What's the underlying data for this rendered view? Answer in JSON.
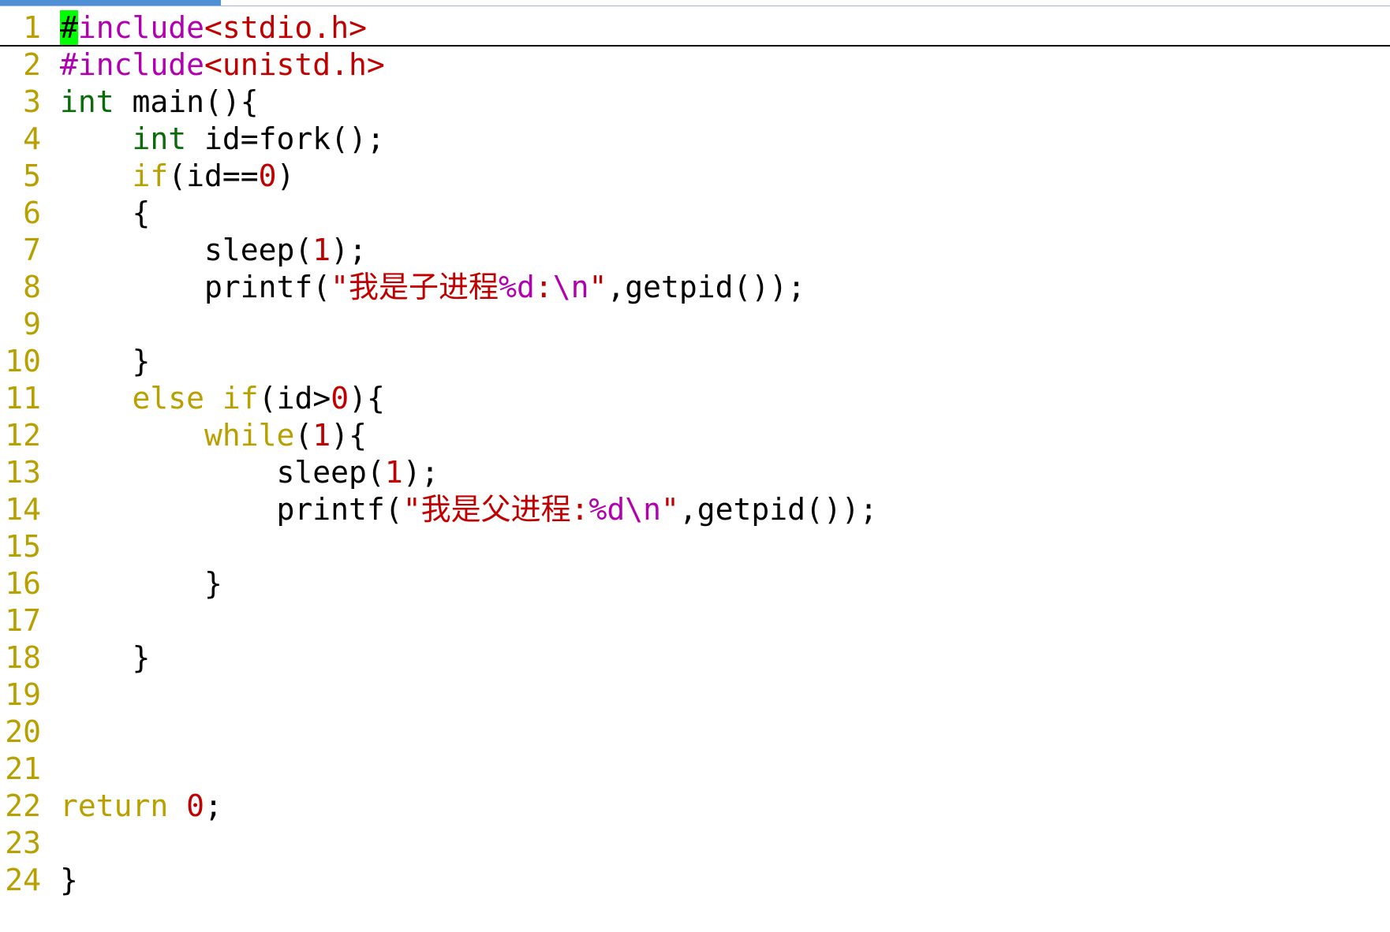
{
  "editor": {
    "lines": [
      {
        "num": "1",
        "segments": [
          {
            "text": "#",
            "cls": "cursor"
          },
          {
            "text": "include",
            "cls": "pp"
          },
          {
            "text": "<stdio.h>",
            "cls": "str"
          }
        ]
      },
      {
        "num": "2",
        "segments": [
          {
            "text": "#include",
            "cls": "pp"
          },
          {
            "text": "<unistd.h>",
            "cls": "str"
          }
        ]
      },
      {
        "num": "3",
        "segments": [
          {
            "text": "int",
            "cls": "kw-type"
          },
          {
            "text": " main(){",
            "cls": ""
          }
        ]
      },
      {
        "num": "4",
        "segments": [
          {
            "text": "    ",
            "cls": ""
          },
          {
            "text": "int",
            "cls": "kw-type"
          },
          {
            "text": " id=fork();",
            "cls": ""
          }
        ]
      },
      {
        "num": "5",
        "segments": [
          {
            "text": "    ",
            "cls": ""
          },
          {
            "text": "if",
            "cls": "kw-ctrl"
          },
          {
            "text": "(id==",
            "cls": ""
          },
          {
            "text": "0",
            "cls": "num"
          },
          {
            "text": ")",
            "cls": ""
          }
        ]
      },
      {
        "num": "6",
        "segments": [
          {
            "text": "    {",
            "cls": ""
          }
        ]
      },
      {
        "num": "7",
        "segments": [
          {
            "text": "        sleep(",
            "cls": ""
          },
          {
            "text": "1",
            "cls": "num"
          },
          {
            "text": ");",
            "cls": ""
          }
        ]
      },
      {
        "num": "8",
        "segments": [
          {
            "text": "        printf(",
            "cls": ""
          },
          {
            "text": "\"我是子进程",
            "cls": "str"
          },
          {
            "text": "%d",
            "cls": "fmt"
          },
          {
            "text": ":",
            "cls": "str"
          },
          {
            "text": "\\n",
            "cls": "fmt"
          },
          {
            "text": "\"",
            "cls": "str"
          },
          {
            "text": ",getpid());",
            "cls": ""
          }
        ]
      },
      {
        "num": "9",
        "segments": []
      },
      {
        "num": "10",
        "segments": [
          {
            "text": "    }",
            "cls": ""
          }
        ]
      },
      {
        "num": "11",
        "segments": [
          {
            "text": "    ",
            "cls": ""
          },
          {
            "text": "else",
            "cls": "kw-ctrl"
          },
          {
            "text": " ",
            "cls": ""
          },
          {
            "text": "if",
            "cls": "kw-ctrl"
          },
          {
            "text": "(id>",
            "cls": ""
          },
          {
            "text": "0",
            "cls": "num"
          },
          {
            "text": "){",
            "cls": ""
          }
        ]
      },
      {
        "num": "12",
        "segments": [
          {
            "text": "        ",
            "cls": ""
          },
          {
            "text": "while",
            "cls": "kw-ctrl"
          },
          {
            "text": "(",
            "cls": ""
          },
          {
            "text": "1",
            "cls": "num"
          },
          {
            "text": "){",
            "cls": ""
          }
        ]
      },
      {
        "num": "13",
        "segments": [
          {
            "text": "            sleep(",
            "cls": ""
          },
          {
            "text": "1",
            "cls": "num"
          },
          {
            "text": ");",
            "cls": ""
          }
        ]
      },
      {
        "num": "14",
        "segments": [
          {
            "text": "            printf(",
            "cls": ""
          },
          {
            "text": "\"我是父进程:",
            "cls": "str"
          },
          {
            "text": "%d",
            "cls": "fmt"
          },
          {
            "text": "\\n",
            "cls": "fmt"
          },
          {
            "text": "\"",
            "cls": "str"
          },
          {
            "text": ",getpid());",
            "cls": ""
          }
        ]
      },
      {
        "num": "15",
        "segments": []
      },
      {
        "num": "16",
        "segments": [
          {
            "text": "        }",
            "cls": ""
          }
        ]
      },
      {
        "num": "17",
        "segments": []
      },
      {
        "num": "18",
        "segments": [
          {
            "text": "    }",
            "cls": ""
          }
        ]
      },
      {
        "num": "19",
        "segments": []
      },
      {
        "num": "20",
        "segments": []
      },
      {
        "num": "21",
        "segments": []
      },
      {
        "num": "22",
        "segments": [
          {
            "text": "return",
            "cls": "kw-ctrl"
          },
          {
            "text": " ",
            "cls": ""
          },
          {
            "text": "0",
            "cls": "num"
          },
          {
            "text": ";",
            "cls": ""
          }
        ]
      },
      {
        "num": "23",
        "segments": []
      },
      {
        "num": "24",
        "segments": [
          {
            "text": "}",
            "cls": ""
          }
        ]
      }
    ]
  },
  "colors": {
    "line_number": "#b8a000",
    "type_keyword": "#0b6b0b",
    "control_keyword": "#b8a000",
    "preprocessor": "#b000b0",
    "string_literal": "#c00000",
    "cursor": "#00ff00"
  }
}
